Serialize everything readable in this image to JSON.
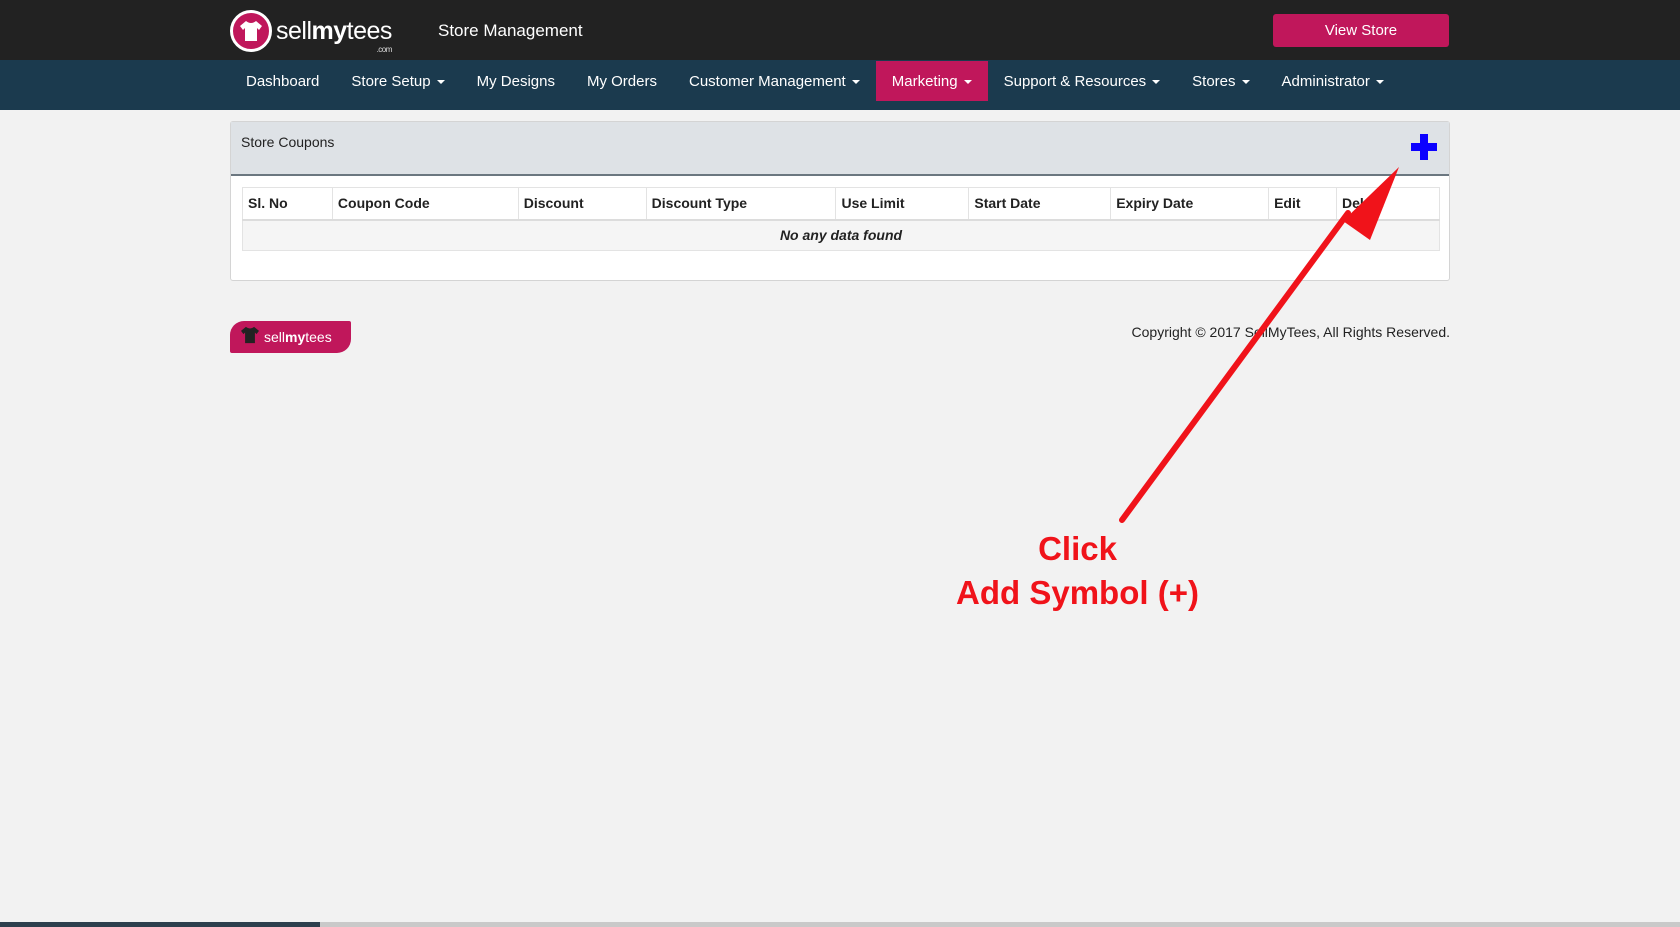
{
  "header": {
    "logo": {
      "text_light": "sell",
      "text_bold": "my",
      "text_light2": "tees",
      "suffix": ".com"
    },
    "title": "Store Management",
    "view_store_label": "View Store",
    "brand_color": "#c0175b"
  },
  "nav": {
    "items": [
      {
        "label": "Dashboard",
        "dropdown": false
      },
      {
        "label": "Store Setup",
        "dropdown": true
      },
      {
        "label": "My Designs",
        "dropdown": false
      },
      {
        "label": "My Orders",
        "dropdown": false
      },
      {
        "label": "Customer Management",
        "dropdown": true
      },
      {
        "label": "Marketing",
        "dropdown": true,
        "active": true
      },
      {
        "label": "Support & Resources",
        "dropdown": true
      },
      {
        "label": "Stores",
        "dropdown": true
      },
      {
        "label": "Administrator",
        "dropdown": true
      }
    ]
  },
  "panel": {
    "title": "Store Coupons",
    "add_icon": "plus-icon",
    "table": {
      "headers": [
        "Sl. No",
        "Coupon Code",
        "Discount",
        "Discount Type",
        "Use Limit",
        "Start Date",
        "Expiry Date",
        "Edit",
        "Delete"
      ],
      "empty_text": "No any data found"
    }
  },
  "footer": {
    "logo": {
      "text_light": "sell",
      "text_bold": "my",
      "text_light2": "tees"
    },
    "copyright": "Copyright © 2017 SellMyTees, All Rights Reserved."
  },
  "annotation": {
    "line1": "Click",
    "line2": "Add Symbol (+)",
    "color": "#f0131a"
  }
}
